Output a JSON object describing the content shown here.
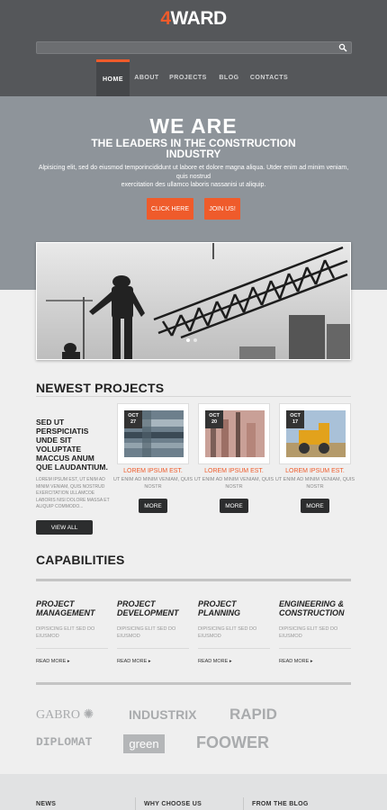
{
  "header": {
    "logo_accent": "4",
    "logo_rest": "WARD",
    "search_placeholder": "",
    "nav": [
      "HOME",
      "ABOUT",
      "PROJECTS",
      "BLOG",
      "CONTACTS"
    ]
  },
  "hero": {
    "title": "WE ARE",
    "subtitle_line1": "THE LEADERS IN THE CONSTRUCTION",
    "subtitle_line2": "INDUSTRY",
    "text_line1": "Alpisicing elit, sed do eiusmod temporincididunt ut labore et dolore magna aliqua. Utder enim ad minim veniam, quis nostrud",
    "text_line2": "exercitation des ullamco laboris nassanisi ut aliquip.",
    "btn_click": "CLICK HERE",
    "btn_join": "JOIN US!"
  },
  "projects": {
    "title": "NEWEST PROJECTS",
    "intro_heading": "SED UT PERSPICIATIS UNDE SIT VOLUPTATE MACCUS ANUM QUE LAUDANTIUM.",
    "intro_text": "LOREM IPSUM EST, UT ENIM AD MINIM VENIAM, QUIS NOSTRUD EXERCITATION ULLAMCOE LABORIS NISI DOLORE MASSA ET ALIQUIP COMMODO...",
    "view_all": "VIEW ALL",
    "cards": [
      {
        "month": "OCT",
        "day": "27",
        "title": "LOREM IPSUM EST.",
        "sub": "UT ENIM AD MINIM VENIAM, QUIS NOSTR",
        "more": "MORE"
      },
      {
        "month": "OCT",
        "day": "20",
        "title": "LOREM IPSUM EST.",
        "sub": "UT ENIM AD MINIM VENIAM, QUIS NOSTR",
        "more": "MORE"
      },
      {
        "month": "OCT",
        "day": "17",
        "title": "LOREM IPSUM EST.",
        "sub": "UT ENIM AD MINIM VENIAM, QUIS NOSTR",
        "more": "MORE"
      }
    ]
  },
  "capabilities": {
    "title": "CAPABILITIES",
    "items": [
      {
        "h1": "PROJECT",
        "h2": "MANAGEMENT",
        "text": "DIPISICING ELIT SED DO EIUSMOD",
        "link": "READ MORE"
      },
      {
        "h1": "PROJECT",
        "h2": "DEVELOPMENT",
        "text": "DIPISICING ELIT SED DO EIUSMOD",
        "link": "READ MORE"
      },
      {
        "h1": "PROJECT",
        "h2": "PLANNING",
        "text": "DIPISICING ELIT SED DO EIUSMOD",
        "link": "READ MORE"
      },
      {
        "h1": "ENGINEERING &",
        "h2": "CONSTRUCTION",
        "text": "DIPISICING ELIT SED DO EIUSMOD",
        "link": "READ MORE"
      }
    ]
  },
  "partners": [
    "GABRO",
    "INDUSTRIX",
    "RAPID",
    "DIPLOMAT",
    "green",
    "FOOWER"
  ],
  "footer": [
    "NEWS",
    "WHY CHOOSE US",
    "FROM THE BLOG"
  ]
}
